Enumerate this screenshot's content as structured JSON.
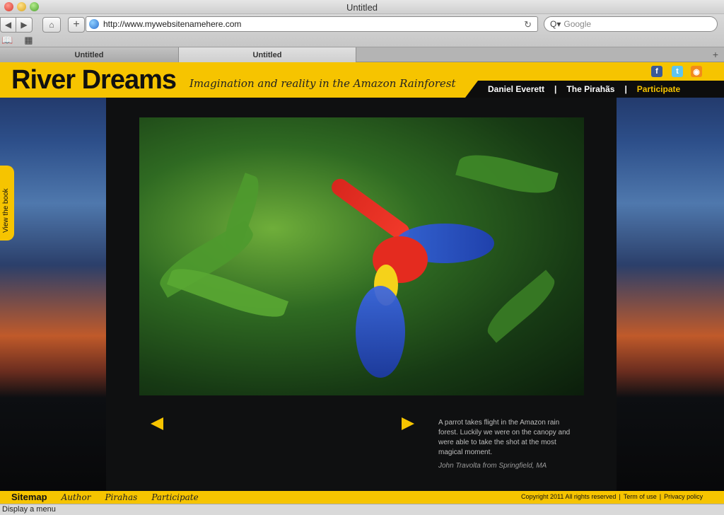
{
  "window": {
    "title": "Untitled"
  },
  "toolbar": {
    "back_icon": "◀",
    "forward_icon": "▶",
    "home_icon": "⌂",
    "add_icon": "+",
    "url": "http://www.mywebsitenamehere.com",
    "reload_icon": "↻",
    "search_placeholder": "Google",
    "search_icon": "Q▾",
    "bookmarks_icon": "📖",
    "topsites_icon": "▦"
  },
  "tabs": [
    {
      "label": "Untitled"
    },
    {
      "label": "Untitled"
    }
  ],
  "new_tab_icon": "+",
  "site": {
    "logo": "River Dreams",
    "tagline": "Imagination and reality in the Amazon Rainforest",
    "nav": [
      {
        "label": "Daniel Everett"
      },
      {
        "label": "The Pirahãs"
      },
      {
        "label": "Participate"
      }
    ],
    "nav_separator": "|",
    "social": {
      "facebook": "f",
      "twitter": "t",
      "rss": "◉"
    },
    "view_book": "View the book",
    "caption": "A parrot takes flight in the Amazon rain forest. Luckily we were on the canopy and were able to take the shot at the most magical moment.",
    "credit": "John Travolta from Springfield, MA",
    "footer": {
      "sitemap": "Sitemap",
      "links": [
        "Author",
        "Pirahas",
        "Participate"
      ],
      "copyright": "Copyright 2011 All rights reserved",
      "terms": "Term of use",
      "privacy": "Privacy policy",
      "separator": "|"
    },
    "colors": {
      "accent": "#f6c400",
      "dark": "#0f1011"
    }
  },
  "status_bar": {
    "text": "Display a menu"
  }
}
